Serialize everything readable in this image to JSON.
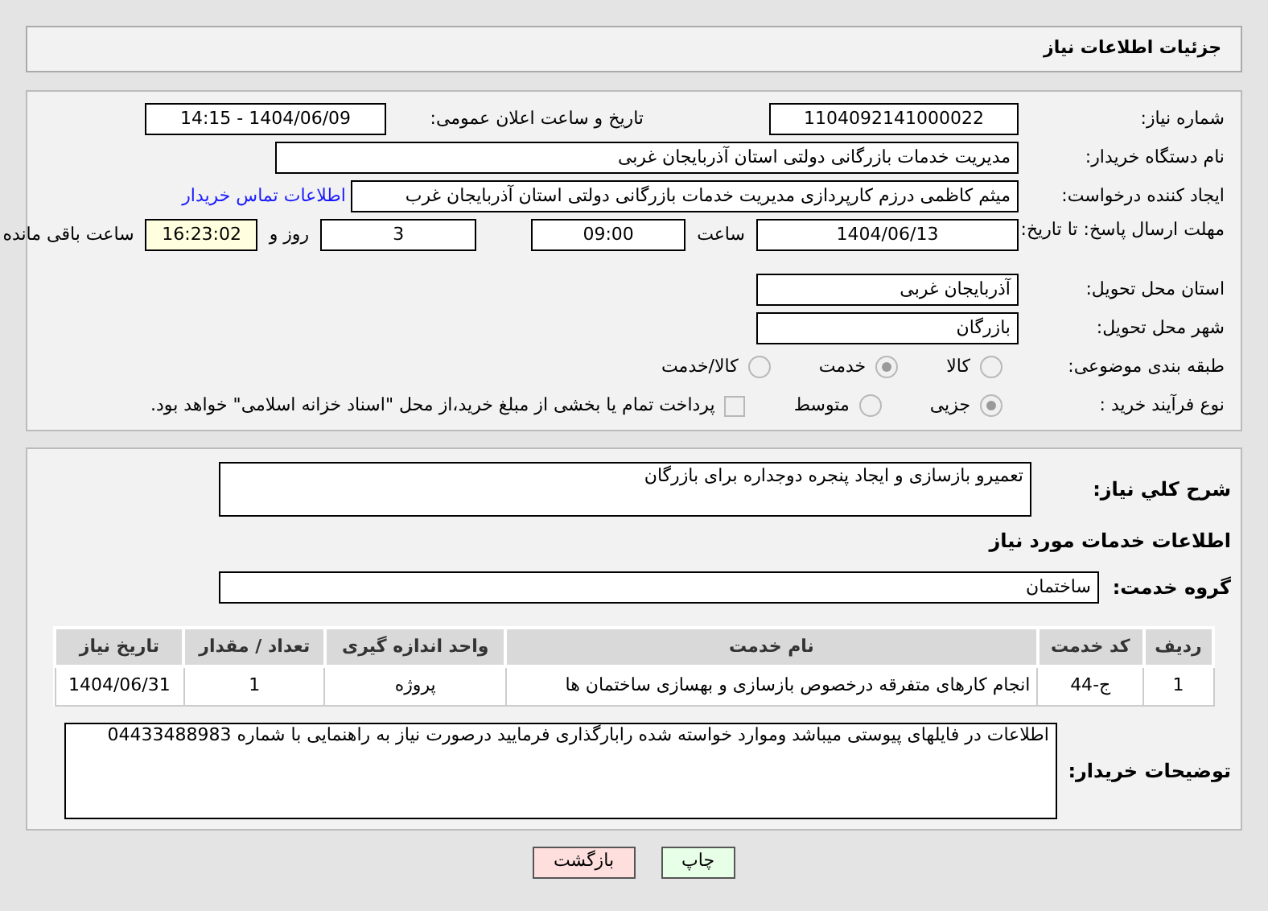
{
  "header": {
    "title": "جزئیات اطلاعات نیاز"
  },
  "need_number": {
    "label": "شماره نیاز:",
    "value": "1104092141000022"
  },
  "announce": {
    "label": "تاریخ و ساعت اعلان عمومی:",
    "value": "1404/06/09 - 14:15"
  },
  "buyer_org": {
    "label": "نام دستگاه خریدار:",
    "value": "مدیریت خدمات بازرگانی دولتی استان آذربایجان غربی"
  },
  "requester": {
    "label": "ایجاد کننده درخواست:",
    "value": "میثم کاظمی درزم کارپردازی مدیریت خدمات بازرگانی دولتی استان آذربایجان غرب",
    "link": "اطلاعات تماس خریدار"
  },
  "deadline": {
    "label": "مهلت ارسال پاسخ: تا تاریخ:",
    "date": "1404/06/13",
    "time_label": "ساعت",
    "time": "09:00",
    "days": "3",
    "days_label": "روز و",
    "remaining": "16:23:02",
    "remaining_label": "ساعت باقی مانده"
  },
  "province": {
    "label": "استان محل تحویل:",
    "value": "آذربایجان غربی"
  },
  "city": {
    "label": "شهر محل تحویل:",
    "value": "بازرگان"
  },
  "category": {
    "label": "طبقه بندی موضوعی:",
    "options": [
      {
        "label": "کالا",
        "selected": false
      },
      {
        "label": "خدمت",
        "selected": true
      },
      {
        "label": "کالا/خدمت",
        "selected": false
      }
    ]
  },
  "process": {
    "label": "نوع فرآیند خرید :",
    "options": [
      {
        "label": "جزیی",
        "selected": true
      },
      {
        "label": "متوسط",
        "selected": false
      }
    ],
    "payment": {
      "label": "پرداخت تمام یا بخشی از مبلغ خرید،از محل \"اسناد خزانه اسلامی\" خواهد بود.",
      "checked": false
    }
  },
  "description": {
    "label": "شرح کلي نياز:",
    "value": "تعمیرو بازسازی و ایجاد پنجره دوجداره برای بازرگان"
  },
  "services_title": "اطلاعات خدمات مورد نیاز",
  "service_group": {
    "label": "گروه خدمت:",
    "value": "ساختمان"
  },
  "table": {
    "columns": [
      "ردیف",
      "کد خدمت",
      "نام خدمت",
      "واحد اندازه گیری",
      "تعداد / مقدار",
      "تاریخ نیاز"
    ],
    "rows": [
      [
        "1",
        "ج-44",
        "انجام کارهای متفرقه درخصوص بازسازی و بهسازی ساختمان ها",
        "پروژه",
        "1",
        "1404/06/31"
      ]
    ]
  },
  "notes": {
    "label": "توضیحات خریدار:",
    "value": "اطلاعات در فایلهای پیوستی میباشد وموارد خواسته شده رابارگذاری فرمایید درصورت نیاز به راهنمایی با شماره 04433488983"
  },
  "buttons": [
    {
      "label": "چاپ",
      "kind": "print"
    },
    {
      "label": "بازگشت",
      "kind": "back"
    }
  ]
}
